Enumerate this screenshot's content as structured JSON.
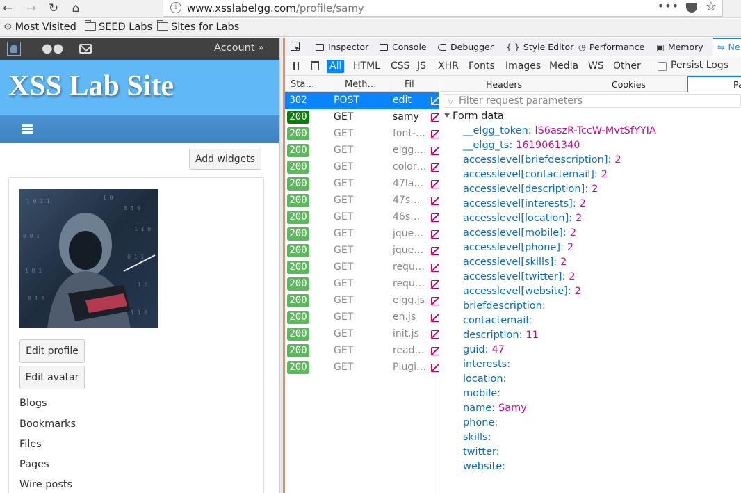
{
  "browser": {
    "url_domain": "www.xsslabelgg.com",
    "url_path": "/profile/samy",
    "url_dots": "•••",
    "bookmarks": [
      "Most Visited",
      "SEED Labs",
      "Sites for Labs"
    ]
  },
  "site": {
    "account_label": "Account »",
    "title": "XSS Lab Site",
    "add_widgets": "Add widgets",
    "edit_profile": "Edit profile",
    "edit_avatar": "Edit avatar",
    "links": [
      "Blogs",
      "Bookmarks",
      "Files",
      "Pages",
      "Wire posts"
    ]
  },
  "devtools": {
    "tabs": [
      "Inspector",
      "Console",
      "Debugger",
      "Style Editor",
      "Performance",
      "Memory",
      "Ne"
    ],
    "tab_icons": [
      "pick-icon",
      "inspector-icon",
      "console-icon",
      "debugger-icon",
      "style-editor-icon",
      "performance-icon",
      "memory-icon",
      "network-icon"
    ],
    "filter_types": [
      "All",
      "HTML",
      "CSS",
      "JS",
      "XHR",
      "Fonts",
      "Images",
      "Media",
      "WS",
      "Other"
    ],
    "active_filter": "All",
    "persist_logs": "Persist Logs",
    "columns": [
      "Sta…",
      "Meth…",
      "Fil"
    ],
    "requests": [
      {
        "status": "302",
        "method": "POST",
        "file": "edit",
        "selected": true
      },
      {
        "status": "200",
        "method": "GET",
        "file": "samy",
        "bold": true
      },
      {
        "status": "200",
        "method": "GET",
        "file": "font-…"
      },
      {
        "status": "200",
        "method": "GET",
        "file": "elgg.…"
      },
      {
        "status": "200",
        "method": "GET",
        "file": "color…"
      },
      {
        "status": "200",
        "method": "GET",
        "file": "47lar…"
      },
      {
        "status": "200",
        "method": "GET",
        "file": "47s…"
      },
      {
        "status": "200",
        "method": "GET",
        "file": "46s…"
      },
      {
        "status": "200",
        "method": "GET",
        "file": "jque…"
      },
      {
        "status": "200",
        "method": "GET",
        "file": "jque…"
      },
      {
        "status": "200",
        "method": "GET",
        "file": "requ…"
      },
      {
        "status": "200",
        "method": "GET",
        "file": "requ…"
      },
      {
        "status": "200",
        "method": "GET",
        "file": "elgg.js"
      },
      {
        "status": "200",
        "method": "GET",
        "file": "en.js"
      },
      {
        "status": "200",
        "method": "GET",
        "file": "init.js"
      },
      {
        "status": "200",
        "method": "GET",
        "file": "read…"
      },
      {
        "status": "200",
        "method": "GET",
        "file": "Plugi…"
      }
    ],
    "detail_tabs": [
      "Headers",
      "Cookies",
      "Pa"
    ],
    "filter_placeholder": "Filter request parameters",
    "form_data_label": "Form data",
    "params": [
      {
        "key": "__elgg_token:",
        "value": "lS6aszR-TccW-MvtSfYYIA"
      },
      {
        "key": "__elgg_ts:",
        "value": "1619061340"
      },
      {
        "key": "accesslevel[briefdescription]:",
        "value": "2"
      },
      {
        "key": "accesslevel[contactemail]:",
        "value": "2"
      },
      {
        "key": "accesslevel[description]:",
        "value": "2"
      },
      {
        "key": "accesslevel[interests]:",
        "value": "2"
      },
      {
        "key": "accesslevel[location]:",
        "value": "2"
      },
      {
        "key": "accesslevel[mobile]:",
        "value": "2"
      },
      {
        "key": "accesslevel[phone]:",
        "value": "2"
      },
      {
        "key": "accesslevel[skills]:",
        "value": "2"
      },
      {
        "key": "accesslevel[twitter]:",
        "value": "2"
      },
      {
        "key": "accesslevel[website]:",
        "value": "2"
      },
      {
        "key": "briefdescription:",
        "value": ""
      },
      {
        "key": "contactemail:",
        "value": ""
      },
      {
        "key": "description:",
        "value": "11"
      },
      {
        "key": "guid:",
        "value": "47"
      },
      {
        "key": "interests:",
        "value": ""
      },
      {
        "key": "location:",
        "value": ""
      },
      {
        "key": "mobile:",
        "value": ""
      },
      {
        "key": "name:",
        "value": "Samy"
      },
      {
        "key": "phone:",
        "value": ""
      },
      {
        "key": "skills:",
        "value": ""
      },
      {
        "key": "twitter:",
        "value": ""
      },
      {
        "key": "website:",
        "value": ""
      }
    ]
  }
}
